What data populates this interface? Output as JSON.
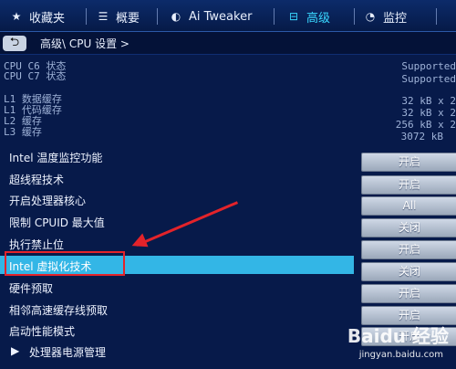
{
  "tabs": [
    {
      "label": "收藏夹",
      "icon": "star-icon"
    },
    {
      "label": "概要",
      "icon": "list-icon"
    },
    {
      "label": "Ai Tweaker",
      "icon": "tweaker-icon"
    },
    {
      "label": "高级",
      "icon": "advanced-icon"
    },
    {
      "label": "监控",
      "icon": "monitor-icon"
    }
  ],
  "breadcrumb": {
    "back_label": "⮌",
    "path": "高级\\ CPU 设置 >"
  },
  "info": [
    {
      "label": "CPU C6 状态",
      "value": "Supported"
    },
    {
      "label": "CPU C7 状态",
      "value": "Supported"
    },
    {
      "label": "L1 数据缓存",
      "value": "32 kB x 2"
    },
    {
      "label": "L1 代码缓存",
      "value": "32 kB x 2"
    },
    {
      "label": "L2 缓存",
      "value": "256 kB x 2"
    },
    {
      "label": "L3 缓存",
      "value": "3072 kB"
    }
  ],
  "settings": [
    {
      "label": "Intel 温度监控功能",
      "value": "开启"
    },
    {
      "label": "超线程技术",
      "value": "开启"
    },
    {
      "label": "开启处理器核心",
      "value": "All"
    },
    {
      "label": "限制 CPUID 最大值",
      "value": "关闭"
    },
    {
      "label": "执行禁止位",
      "value": "开启"
    },
    {
      "label": "Intel 虚拟化技术",
      "value": "关闭"
    },
    {
      "label": "硬件预取",
      "value": "开启"
    },
    {
      "label": "相邻高速缓存线预取",
      "value": "开启"
    },
    {
      "label": "启动性能模式",
      "value": "开启"
    },
    {
      "label": "处理器电源管理",
      "value": ""
    }
  ],
  "watermark": {
    "logo": "Baidu 经验",
    "url": "jingyan.baidu.com"
  },
  "colors": {
    "accent": "#39d7ff",
    "selected": "#33b6e6",
    "annotation": "#e3232a"
  }
}
